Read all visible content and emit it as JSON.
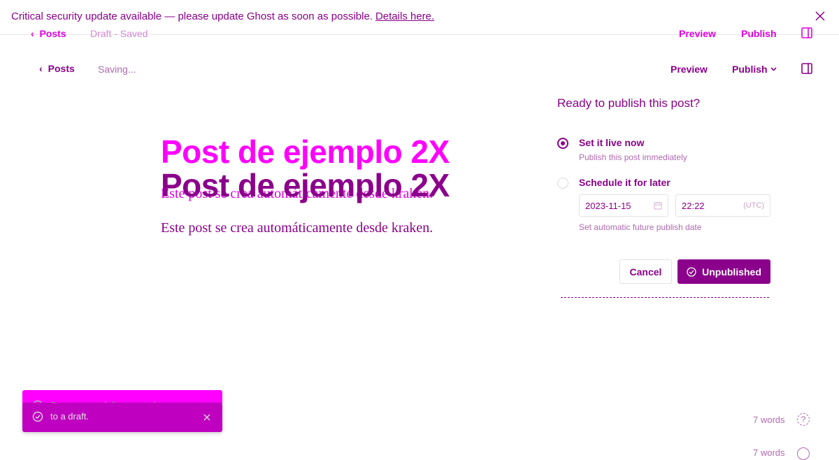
{
  "banner": {
    "message": "Critical security update available — please update Ghost as soon as possible.",
    "link_text": "Details here."
  },
  "ghost_nav": {
    "back_label": "Posts",
    "status": "Draft - Saved",
    "preview_label": "Preview",
    "publish_label": "Publish"
  },
  "editor_nav": {
    "back_label": "Posts",
    "status": "Saving...",
    "preview_label": "Preview",
    "publish_label": "Publish"
  },
  "editor": {
    "title": "Post de ejemplo 2X",
    "body": "Este post se crea automáticamente desde kraken."
  },
  "publish_menu": {
    "heading": "Ready to publish this post?",
    "options": [
      {
        "title": "Set it live now",
        "description": "Publish this post immediately",
        "selected": true
      },
      {
        "title": "Schedule it for later",
        "description": "Set automatic future publish date",
        "selected": false
      }
    ],
    "date_value": "2023-11-15",
    "time_value": "22:22",
    "timezone": "(UTC)",
    "cancel_label": "Cancel",
    "confirm_label": "Unpublished"
  },
  "toasts": {
    "line1": "Post successfully reverted",
    "line2": "to a draft."
  },
  "footer": {
    "word_count": "7 words",
    "help_symbol": "?"
  },
  "colors": {
    "accent": "#8b008b",
    "accent_bright": "#ff00ff",
    "toast_front": "#c000c0"
  },
  "icons": [
    "close-icon",
    "chevron-left-icon",
    "chevron-down-icon",
    "sidebar-toggle-icon",
    "calendar-icon",
    "check-circle-icon",
    "help-icon"
  ]
}
